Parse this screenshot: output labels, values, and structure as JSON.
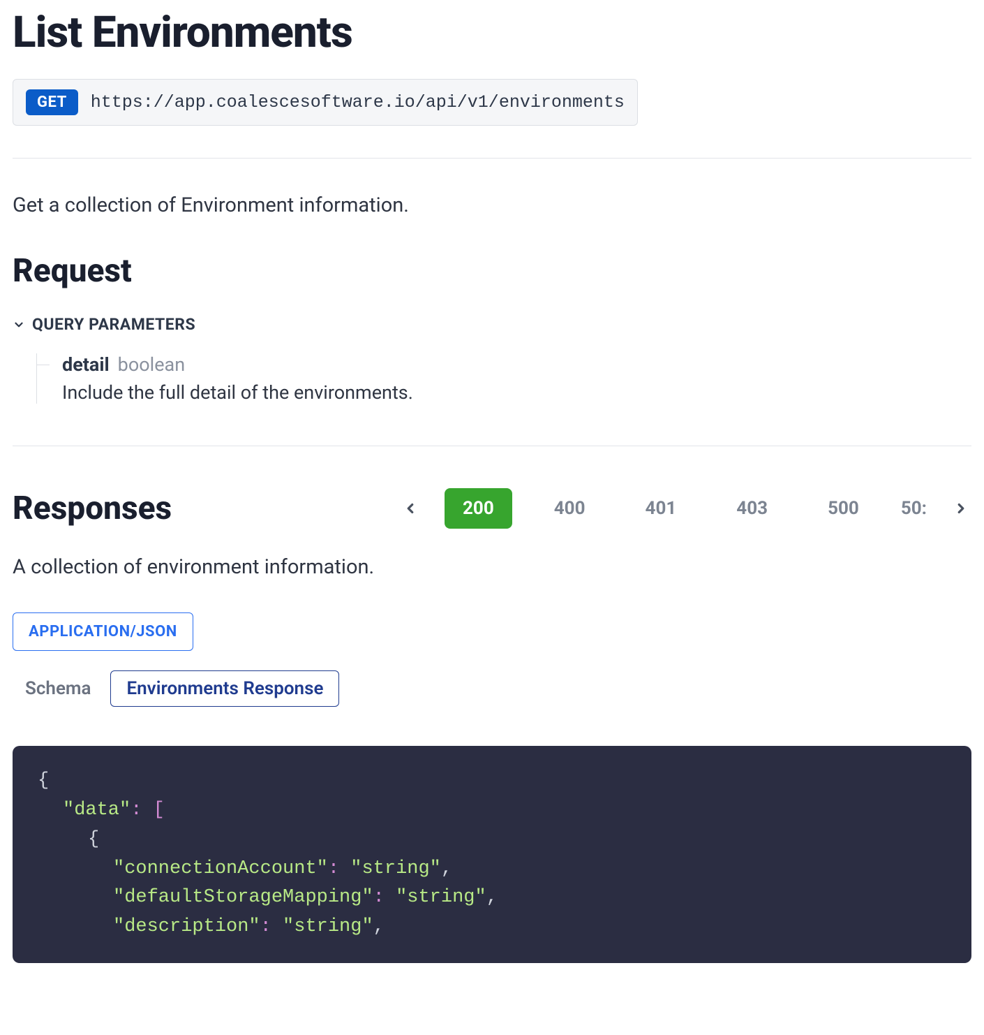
{
  "title": "List Environments",
  "endpoint": {
    "method": "GET",
    "url": "https://app.coalescesoftware.io/api/v1/environments"
  },
  "description": "Get a collection of Environment information.",
  "request": {
    "heading": "Request",
    "query_params_label": "QUERY PARAMETERS",
    "params": [
      {
        "name": "detail",
        "type": "boolean",
        "description": "Include the full detail of the environments."
      }
    ]
  },
  "responses": {
    "heading": "Responses",
    "codes": [
      "200",
      "400",
      "401",
      "403",
      "500"
    ],
    "truncated": "50:",
    "active_code": "200",
    "description": "A collection of environment information.",
    "content_type": "APPLICATION/JSON",
    "tabs": {
      "schema": "Schema",
      "example": "Environments Response"
    }
  },
  "code": {
    "lines": [
      {
        "indent": 0,
        "tokens": [
          {
            "t": "brace",
            "v": "{"
          }
        ]
      },
      {
        "indent": 1,
        "tokens": [
          {
            "t": "key",
            "v": "\"data\""
          },
          {
            "t": "colon",
            "v": ":"
          },
          {
            "t": "plain",
            "v": " "
          },
          {
            "t": "bracket",
            "v": "["
          }
        ]
      },
      {
        "indent": 2,
        "tokens": [
          {
            "t": "brace",
            "v": "{"
          }
        ]
      },
      {
        "indent": 3,
        "tokens": [
          {
            "t": "key",
            "v": "\"connectionAccount\""
          },
          {
            "t": "colon",
            "v": ":"
          },
          {
            "t": "plain",
            "v": " "
          },
          {
            "t": "string",
            "v": "\"string\""
          },
          {
            "t": "comma",
            "v": ","
          }
        ]
      },
      {
        "indent": 3,
        "tokens": [
          {
            "t": "key",
            "v": "\"defaultStorageMapping\""
          },
          {
            "t": "colon",
            "v": ":"
          },
          {
            "t": "plain",
            "v": " "
          },
          {
            "t": "string",
            "v": "\"string\""
          },
          {
            "t": "comma",
            "v": ","
          }
        ]
      },
      {
        "indent": 3,
        "tokens": [
          {
            "t": "key",
            "v": "\"description\""
          },
          {
            "t": "colon",
            "v": ":"
          },
          {
            "t": "plain",
            "v": " "
          },
          {
            "t": "string",
            "v": "\"string\""
          },
          {
            "t": "comma",
            "v": ","
          }
        ]
      }
    ]
  }
}
